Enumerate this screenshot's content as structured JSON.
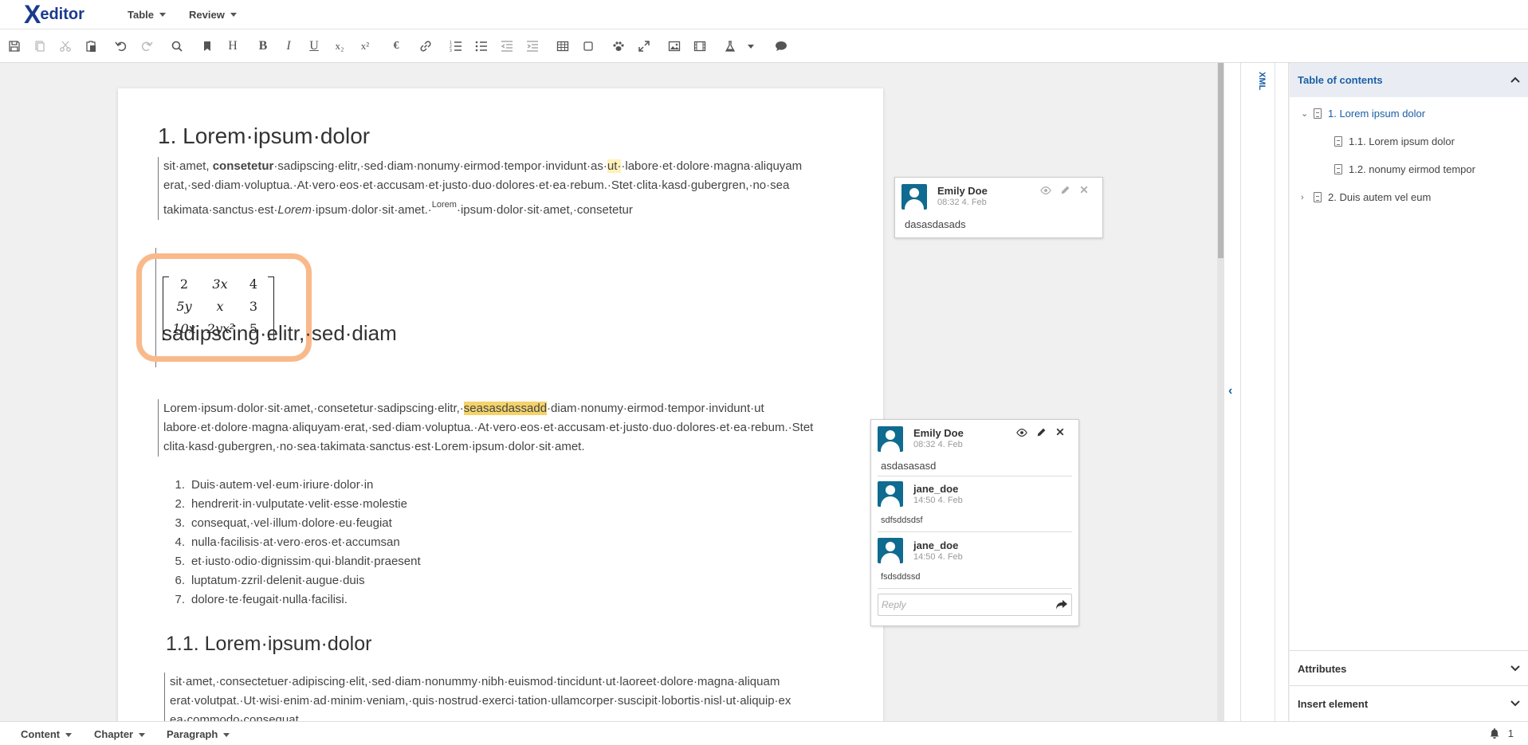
{
  "app": {
    "logo_x": "X",
    "logo_word": "editor"
  },
  "menu": {
    "table": "Table",
    "review": "Review"
  },
  "toolbar": {
    "items": [
      "save-icon",
      "copy-icon",
      "cut-icon",
      "paste-icon",
      "undo-icon",
      "redo-icon",
      "search-icon",
      "bookmark-icon",
      "heading-icon",
      "bold-icon",
      "italic-icon",
      "underline-icon",
      "subscript-icon",
      "superscript-icon",
      "euro-icon",
      "link-icon",
      "ordered-list-icon",
      "bullet-list-icon",
      "outdent-icon",
      "indent-icon",
      "table-icon",
      "box-icon",
      "paw-icon",
      "expand-icon",
      "image-icon",
      "video-icon",
      "flask-icon",
      "flask-dropdown-icon",
      "comment-icon"
    ],
    "heading": "H",
    "bold": "B",
    "italic": "I",
    "underline": "U",
    "sub": "x₂",
    "sup": "x²",
    "euro": "€"
  },
  "document": {
    "h1": "1. Lorem·ipsum·dolor",
    "p1": {
      "a": "sit·amet,",
      "b": "consetetur",
      "c": "·sadipscing·elitr,·sed·diam·nonumy·eirmod·tempor·invidunt·as·",
      "hl": "ut·",
      "d": "·labore·et·dolore·magna·aliquyam",
      "line2": "erat,·sed·diam·voluptua.·At·vero·eos·et·accusam·et·justo·duo·dolores·et·ea·rebum.·Stet·clita·kasd·gubergren,·no·sea",
      "line3a": "takimata·sanctus·est·",
      "line3i": "Lorem",
      "line3b": "·ipsum·dolor·sit·amet.·",
      "line3sup": "Lorem",
      "line3c": "·ipsum·dolor·sit·amet,·consetetur"
    },
    "matrix": [
      [
        "2",
        "3x",
        "4"
      ],
      [
        "5y",
        "x",
        "3"
      ],
      [
        "10x",
        "2yx²",
        "5"
      ]
    ],
    "h2": "sadipscing·elitr,·sed·diam",
    "p2": {
      "a": "Lorem·ipsum·dolor·sit·amet,·consetetur·sadipscing·elitr,·",
      "hl": "seasasdassadd",
      "b": "·diam·nonumy·eirmod·tempor·invidunt·ut",
      "line2": "labore·et·dolore·magna·aliquyam·erat,·sed·diam·voluptua.·At·vero·eos·et·accusam·et·justo·duo·dolores·et·ea·rebum.·Stet",
      "line3": "clita·kasd·gubergren,·no·sea·takimata·sanctus·est·Lorem·ipsum·dolor·sit·amet."
    },
    "list": [
      "Duis·autem·vel·eum·iriure·dolor·in",
      "hendrerit·in·vulputate·velit·esse·molestie",
      "consequat,·vel·illum·dolore·eu·feugiat",
      "nulla·facilisis·at·vero·eros·et·accumsan",
      "et·iusto·odio·dignissim·qui·blandit·praesent",
      "luptatum·zzril·delenit·augue·duis",
      "dolore·te·feugait·nulla·facilisi."
    ],
    "h3": "1.1. Lorem·ipsum·dolor",
    "p3": {
      "line1": "sit·amet,·consectetuer·adipiscing·elit,·sed·diam·nonummy·nibh·euismod·tincidunt·ut·laoreet·dolore·magna·aliquam",
      "line2": "erat·volutpat.·Ut·wisi·enim·ad·minim·veniam,·quis·nostrud·exerci·tation·ullamcorper·suscipit·lobortis·nisl·ut·aliquip·ex",
      "line3": "ea·commodo·consequat."
    }
  },
  "comments": {
    "first": {
      "author": "Emily Doe",
      "date": "08:32 4. Feb",
      "text": "dasasdasads"
    },
    "second": {
      "author": "Emily Doe",
      "date": "08:32 4. Feb",
      "text": "asdasasasd",
      "replies": [
        {
          "author": "jane_doe",
          "date": "14:50 4. Feb",
          "text": "sdfsddsdsf"
        },
        {
          "author": "jane_doe",
          "date": "14:50 4. Feb",
          "text": "fsdsddssd"
        }
      ],
      "reply_placeholder": "Reply"
    }
  },
  "side": {
    "xml_label": "XML"
  },
  "toc": {
    "title": "Table of contents",
    "items": [
      {
        "label": "1. Lorem ipsum dolor"
      },
      {
        "label": "1.1. Lorem ipsum dolor"
      },
      {
        "label": "1.2. nonumy eirmod tempor"
      },
      {
        "label": "2. Duis autem vel eum"
      }
    ],
    "attributes": "Attributes",
    "insert_element": "Insert element"
  },
  "statusbar": {
    "content": "Content",
    "chapter": "Chapter",
    "paragraph": "Paragraph",
    "notifications": "1"
  },
  "colors": {
    "accent": "#1b5fa6",
    "avatar": "#0f6b8f",
    "highlight": "#f4d36b",
    "matrix_border": "#f9b98a"
  }
}
